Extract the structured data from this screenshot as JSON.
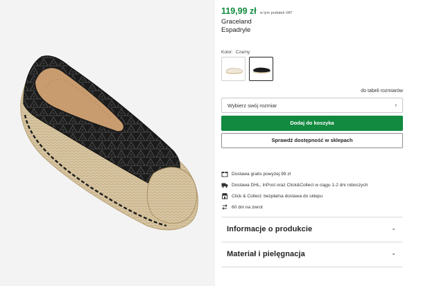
{
  "price": {
    "amount": "119,99 zł",
    "vat_note": "w tym podatek VAT"
  },
  "product": {
    "brand": "Graceland",
    "name": "Espadryle"
  },
  "color": {
    "label": "Kolor:",
    "value": "Czarny"
  },
  "swatches": [
    {
      "name": "swatch-beige",
      "selected": false,
      "color": "#e6ddcc"
    },
    {
      "name": "swatch-black",
      "selected": true,
      "color": "#1c1c1c"
    }
  ],
  "size_guide": "do tabeli rozmiarów",
  "size_select": {
    "placeholder": "Wybierz swój rozmiar",
    "icon": "chevron-right-icon"
  },
  "buttons": {
    "add_to_cart": "Dodaj do koszyka",
    "check_store": "Sprawdź dostępność w sklepach"
  },
  "info_items": [
    {
      "icon": "gift-icon",
      "text": "Dostawa gratis powyżej 99 zł"
    },
    {
      "icon": "truck-icon",
      "text": "Dostawa DHL, InPost oraz Click&Collect w ciągu 1-2 dni roboczych"
    },
    {
      "icon": "store-icon",
      "text": "Click & Collect: bezpłatna dostawa do sklepu"
    },
    {
      "icon": "return-icon",
      "text": "60 dni na zwrot"
    }
  ],
  "accordions": [
    {
      "label": "Informacje o produkcie",
      "icon": "chevron-down-icon"
    },
    {
      "label": "Materiał i pielęgnacja",
      "icon": "chevron-down-icon"
    }
  ],
  "colors": {
    "accent": "#128a3f",
    "price": "#0f8a3c",
    "shoe": "#1c1c1c",
    "jute": "#d8c6a3"
  }
}
